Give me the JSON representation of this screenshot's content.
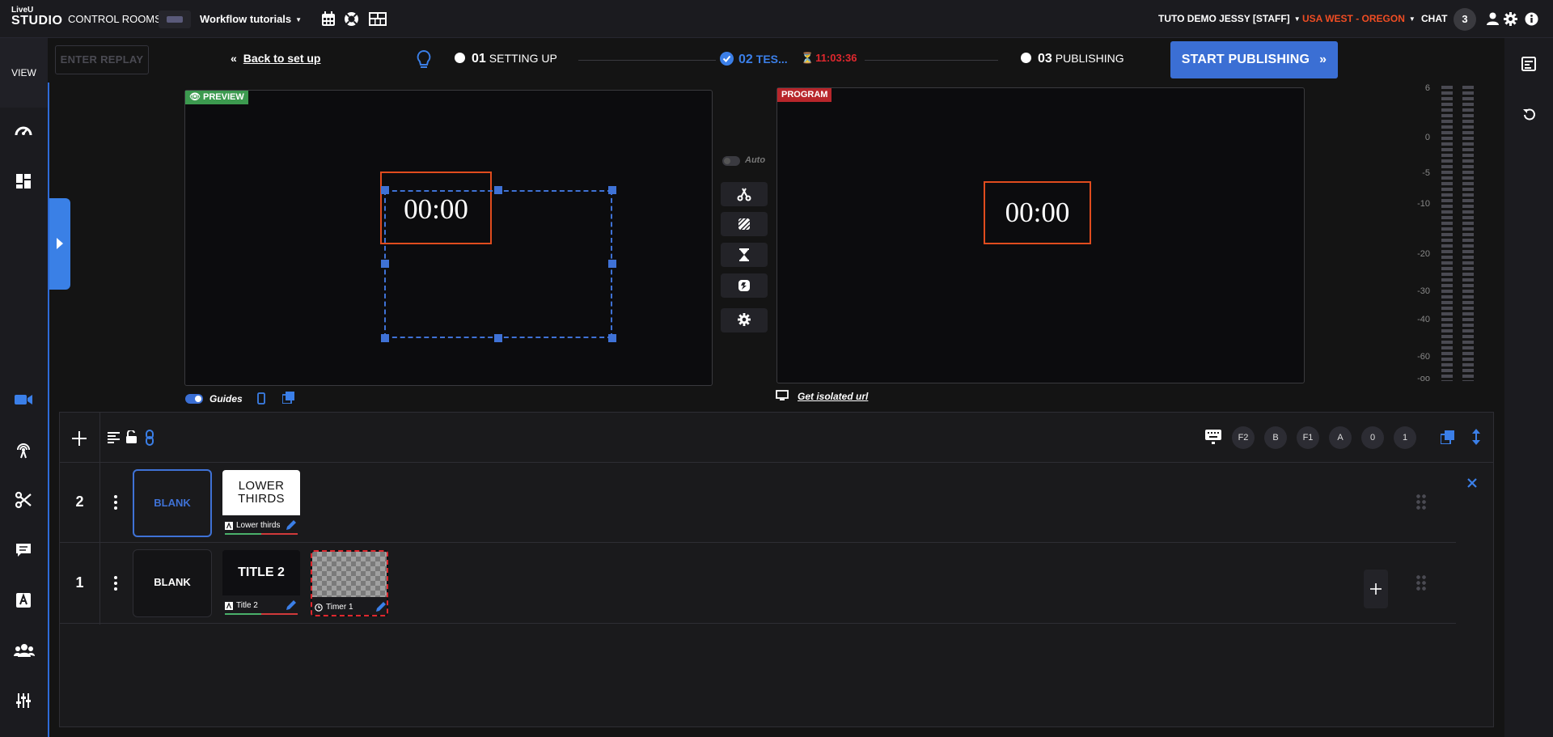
{
  "brand": {
    "line1": "LiveU",
    "line2": "STUDIO"
  },
  "topbar": {
    "control_rooms": "CONTROL ROOMS",
    "room_name": "Workflow tutorials",
    "user": "TUTO DEMO JESSY [STAFF]",
    "region": "USA WEST - OREGON",
    "chat_label": "CHAT",
    "chat_count": "3",
    "colors": {
      "region": "#f04d23",
      "accent": "#3b6fd4"
    }
  },
  "nav": {
    "view_label": "VIEW"
  },
  "status": {
    "replay_label": "ENTER REPLAY",
    "back_label": "Back to set up",
    "step1_num": "01",
    "step1_label": "SETTING UP",
    "step2_num": "02",
    "step2_label": "TES...",
    "step2_timer": "11:03:36",
    "step3_num": "03",
    "step3_label": "PUBLISHING",
    "start_label": "START PUBLISHING"
  },
  "preview": {
    "label": "PREVIEW",
    "timer": "00:00",
    "guides_label": "Guides"
  },
  "program": {
    "label": "PROGRAM",
    "timer": "00:00",
    "iso_label": "Get isolated url"
  },
  "controls": {
    "auto_label": "Auto"
  },
  "vu_scale": [
    "6",
    "0",
    "-5",
    "-10",
    "-20",
    "-30",
    "-40",
    "-60",
    "-oo"
  ],
  "layers_toolbar": {
    "shortcut_keys": [
      "F2",
      "B",
      "F1",
      "A",
      "0",
      "1"
    ]
  },
  "layers": [
    {
      "number": "2",
      "blank_label": "BLANK",
      "sources": [
        {
          "thumb_text": "LOWER THIRDS",
          "name": "Lower thirds"
        }
      ]
    },
    {
      "number": "1",
      "blank_label": "BLANK",
      "sources": [
        {
          "thumb_text": "TITLE 2",
          "name": "Title 2"
        },
        {
          "thumb_text": "",
          "name": "Timer 1"
        }
      ]
    }
  ]
}
